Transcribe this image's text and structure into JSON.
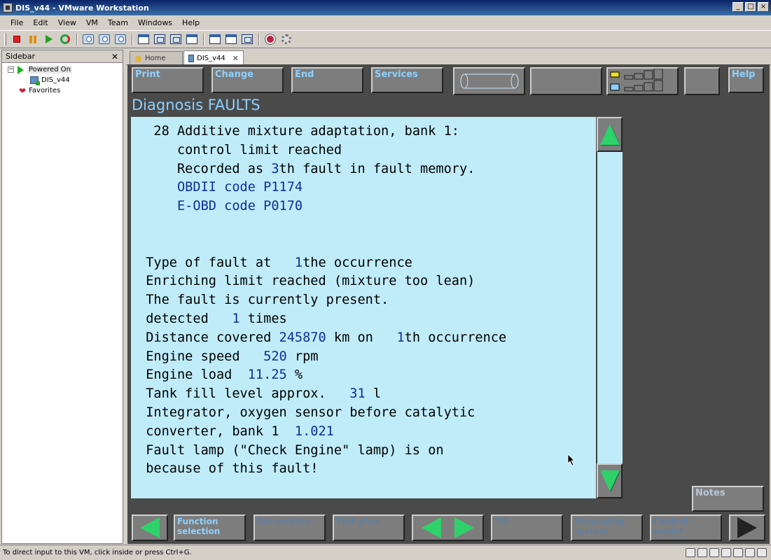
{
  "window": {
    "title": "DIS_v44 - VMware Workstation"
  },
  "menu": [
    "File",
    "Edit",
    "View",
    "VM",
    "Team",
    "Windows",
    "Help"
  ],
  "sidebar": {
    "title": "Sidebar",
    "powered_on": "Powered On",
    "vm_name": "DIS_v44",
    "favorites": "Favorites"
  },
  "tabs": {
    "home": "Home",
    "vm": "DIS_v44"
  },
  "dis": {
    "top_buttons": {
      "print": "Print",
      "change": "Change",
      "end": "End",
      "services": "Services",
      "help": "Help"
    },
    "title": "Diagnosis  FAULTS",
    "fault": {
      "number": "28",
      "line1": "Additive mixture adaptation, bank 1:",
      "line2": "control limit reached",
      "recorded_prefix": "Recorded as ",
      "recorded_value": "3",
      "recorded_suffix": "th fault in fault memory.",
      "obd_code": "OBDII code P1174",
      "eobd_code": "E-OBD code P0170",
      "type_prefix": "Type of fault at   ",
      "type_value": "1",
      "type_suffix": "the occurrence",
      "enriching": "Enriching limit reached (mixture too lean)",
      "present": "The fault is currently present.",
      "detected_prefix": "detected   ",
      "detected_value": "1",
      "detected_suffix": " times",
      "distance_prefix": "Distance covered ",
      "distance_value": "245870",
      "distance_mid": " km on   ",
      "distance_occ": "1",
      "distance_suffix": "th occurrence",
      "speed_prefix": "Engine speed   ",
      "speed_value": "520",
      "speed_suffix": " rpm",
      "load_prefix": "Engine load  ",
      "load_value": "11.25",
      "load_suffix": " %",
      "tank_prefix": "Tank fill level approx.   ",
      "tank_value": "31",
      "tank_suffix": " l",
      "integrator1": "Integrator, oxygen sensor before catalytic",
      "integrator2_prefix": "converter, bank 1  ",
      "integrator2_value": "1.021",
      "lamp1": "Fault lamp (\"Check Engine\" lamp) is on",
      "lamp2": "because of this fault!"
    },
    "notes": "Notes",
    "bottom_buttons": {
      "function_selection_1": "Function",
      "function_selection_2": "selection",
      "documents": "Documents",
      "test_plan": "Test plan",
      "tis": "TIS",
      "measuring_1": "Measuring",
      "measuring_2": "system",
      "control_1": "Control-modul",
      "control_2": "functions"
    }
  },
  "status": {
    "text": "To direct input to this VM, click inside or press Ctrl+G."
  }
}
